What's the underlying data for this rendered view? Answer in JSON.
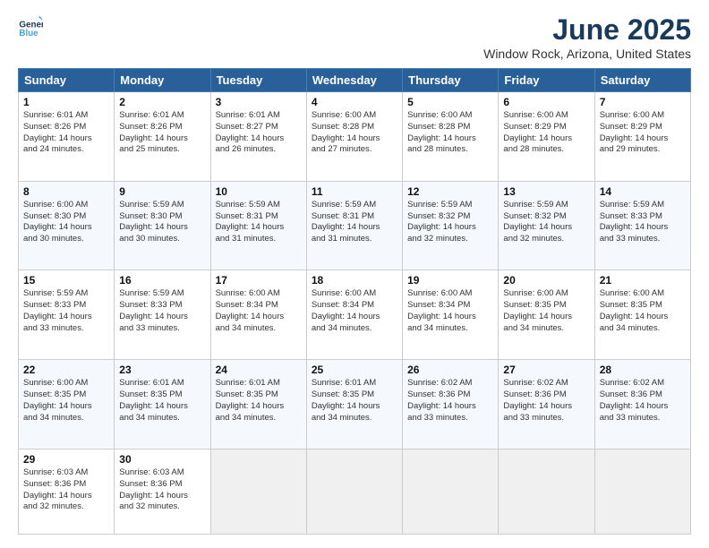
{
  "header": {
    "logo_line1": "General",
    "logo_line2": "Blue",
    "title": "June 2025",
    "subtitle": "Window Rock, Arizona, United States"
  },
  "days_of_week": [
    "Sunday",
    "Monday",
    "Tuesday",
    "Wednesday",
    "Thursday",
    "Friday",
    "Saturday"
  ],
  "weeks": [
    [
      {
        "day": "1",
        "lines": [
          "Sunrise: 6:01 AM",
          "Sunset: 8:26 PM",
          "Daylight: 14 hours",
          "and 24 minutes."
        ]
      },
      {
        "day": "2",
        "lines": [
          "Sunrise: 6:01 AM",
          "Sunset: 8:26 PM",
          "Daylight: 14 hours",
          "and 25 minutes."
        ]
      },
      {
        "day": "3",
        "lines": [
          "Sunrise: 6:01 AM",
          "Sunset: 8:27 PM",
          "Daylight: 14 hours",
          "and 26 minutes."
        ]
      },
      {
        "day": "4",
        "lines": [
          "Sunrise: 6:00 AM",
          "Sunset: 8:28 PM",
          "Daylight: 14 hours",
          "and 27 minutes."
        ]
      },
      {
        "day": "5",
        "lines": [
          "Sunrise: 6:00 AM",
          "Sunset: 8:28 PM",
          "Daylight: 14 hours",
          "and 28 minutes."
        ]
      },
      {
        "day": "6",
        "lines": [
          "Sunrise: 6:00 AM",
          "Sunset: 8:29 PM",
          "Daylight: 14 hours",
          "and 28 minutes."
        ]
      },
      {
        "day": "7",
        "lines": [
          "Sunrise: 6:00 AM",
          "Sunset: 8:29 PM",
          "Daylight: 14 hours",
          "and 29 minutes."
        ]
      }
    ],
    [
      {
        "day": "8",
        "lines": [
          "Sunrise: 6:00 AM",
          "Sunset: 8:30 PM",
          "Daylight: 14 hours",
          "and 30 minutes."
        ]
      },
      {
        "day": "9",
        "lines": [
          "Sunrise: 5:59 AM",
          "Sunset: 8:30 PM",
          "Daylight: 14 hours",
          "and 30 minutes."
        ]
      },
      {
        "day": "10",
        "lines": [
          "Sunrise: 5:59 AM",
          "Sunset: 8:31 PM",
          "Daylight: 14 hours",
          "and 31 minutes."
        ]
      },
      {
        "day": "11",
        "lines": [
          "Sunrise: 5:59 AM",
          "Sunset: 8:31 PM",
          "Daylight: 14 hours",
          "and 31 minutes."
        ]
      },
      {
        "day": "12",
        "lines": [
          "Sunrise: 5:59 AM",
          "Sunset: 8:32 PM",
          "Daylight: 14 hours",
          "and 32 minutes."
        ]
      },
      {
        "day": "13",
        "lines": [
          "Sunrise: 5:59 AM",
          "Sunset: 8:32 PM",
          "Daylight: 14 hours",
          "and 32 minutes."
        ]
      },
      {
        "day": "14",
        "lines": [
          "Sunrise: 5:59 AM",
          "Sunset: 8:33 PM",
          "Daylight: 14 hours",
          "and 33 minutes."
        ]
      }
    ],
    [
      {
        "day": "15",
        "lines": [
          "Sunrise: 5:59 AM",
          "Sunset: 8:33 PM",
          "Daylight: 14 hours",
          "and 33 minutes."
        ]
      },
      {
        "day": "16",
        "lines": [
          "Sunrise: 5:59 AM",
          "Sunset: 8:33 PM",
          "Daylight: 14 hours",
          "and 33 minutes."
        ]
      },
      {
        "day": "17",
        "lines": [
          "Sunrise: 6:00 AM",
          "Sunset: 8:34 PM",
          "Daylight: 14 hours",
          "and 34 minutes."
        ]
      },
      {
        "day": "18",
        "lines": [
          "Sunrise: 6:00 AM",
          "Sunset: 8:34 PM",
          "Daylight: 14 hours",
          "and 34 minutes."
        ]
      },
      {
        "day": "19",
        "lines": [
          "Sunrise: 6:00 AM",
          "Sunset: 8:34 PM",
          "Daylight: 14 hours",
          "and 34 minutes."
        ]
      },
      {
        "day": "20",
        "lines": [
          "Sunrise: 6:00 AM",
          "Sunset: 8:35 PM",
          "Daylight: 14 hours",
          "and 34 minutes."
        ]
      },
      {
        "day": "21",
        "lines": [
          "Sunrise: 6:00 AM",
          "Sunset: 8:35 PM",
          "Daylight: 14 hours",
          "and 34 minutes."
        ]
      }
    ],
    [
      {
        "day": "22",
        "lines": [
          "Sunrise: 6:00 AM",
          "Sunset: 8:35 PM",
          "Daylight: 14 hours",
          "and 34 minutes."
        ]
      },
      {
        "day": "23",
        "lines": [
          "Sunrise: 6:01 AM",
          "Sunset: 8:35 PM",
          "Daylight: 14 hours",
          "and 34 minutes."
        ]
      },
      {
        "day": "24",
        "lines": [
          "Sunrise: 6:01 AM",
          "Sunset: 8:35 PM",
          "Daylight: 14 hours",
          "and 34 minutes."
        ]
      },
      {
        "day": "25",
        "lines": [
          "Sunrise: 6:01 AM",
          "Sunset: 8:35 PM",
          "Daylight: 14 hours",
          "and 34 minutes."
        ]
      },
      {
        "day": "26",
        "lines": [
          "Sunrise: 6:02 AM",
          "Sunset: 8:36 PM",
          "Daylight: 14 hours",
          "and 33 minutes."
        ]
      },
      {
        "day": "27",
        "lines": [
          "Sunrise: 6:02 AM",
          "Sunset: 8:36 PM",
          "Daylight: 14 hours",
          "and 33 minutes."
        ]
      },
      {
        "day": "28",
        "lines": [
          "Sunrise: 6:02 AM",
          "Sunset: 8:36 PM",
          "Daylight: 14 hours",
          "and 33 minutes."
        ]
      }
    ],
    [
      {
        "day": "29",
        "lines": [
          "Sunrise: 6:03 AM",
          "Sunset: 8:36 PM",
          "Daylight: 14 hours",
          "and 32 minutes."
        ]
      },
      {
        "day": "30",
        "lines": [
          "Sunrise: 6:03 AM",
          "Sunset: 8:36 PM",
          "Daylight: 14 hours",
          "and 32 minutes."
        ]
      },
      {
        "day": "",
        "lines": []
      },
      {
        "day": "",
        "lines": []
      },
      {
        "day": "",
        "lines": []
      },
      {
        "day": "",
        "lines": []
      },
      {
        "day": "",
        "lines": []
      }
    ]
  ]
}
